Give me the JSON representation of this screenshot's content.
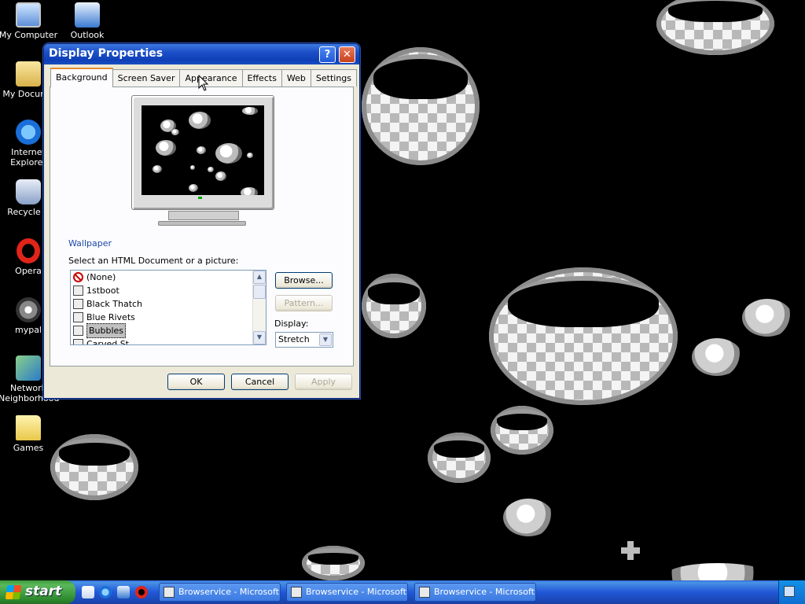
{
  "desktop": {
    "icons": [
      {
        "label": "My Computer",
        "icon": "my-computer-icon"
      },
      {
        "label": "Outlook",
        "icon": "outlook-icon"
      },
      {
        "label": "My Docume",
        "icon": "my-documents-icon"
      },
      {
        "label": "Internet Explorer",
        "icon": "internet-explorer-icon"
      },
      {
        "label": "Recycle B",
        "icon": "recycle-bin-icon"
      },
      {
        "label": "Opera",
        "icon": "opera-icon"
      },
      {
        "label": "mypal",
        "icon": "mypal-icon"
      },
      {
        "label": "Network Neighborhood",
        "icon": "network-icon"
      },
      {
        "label": "Games",
        "icon": "folder-icon"
      }
    ]
  },
  "dialog": {
    "title": "Display Properties",
    "help": "?",
    "close": "✕",
    "tabs": [
      "Background",
      "Screen Saver",
      "Appearance",
      "Effects",
      "Web",
      "Settings"
    ],
    "active_tab": "Background",
    "wallpaper_group": "Wallpaper",
    "select_label": "Select an HTML Document or a picture:",
    "list_items": [
      "(None)",
      "1stboot",
      "Black Thatch",
      "Blue Rivets",
      "Bubbles",
      "Carved St..."
    ],
    "selected_item": "Bubbles",
    "browse": "Browse...",
    "pattern": "Pattern...",
    "display_label": "Display:",
    "display_value": "Stretch",
    "ok": "OK",
    "cancel": "Cancel",
    "apply": "Apply"
  },
  "taskbar": {
    "start": "start",
    "tasks": [
      "Browservice - Microsoft...",
      "Browservice - Microsoft...",
      "Browservice - Microsoft..."
    ]
  }
}
